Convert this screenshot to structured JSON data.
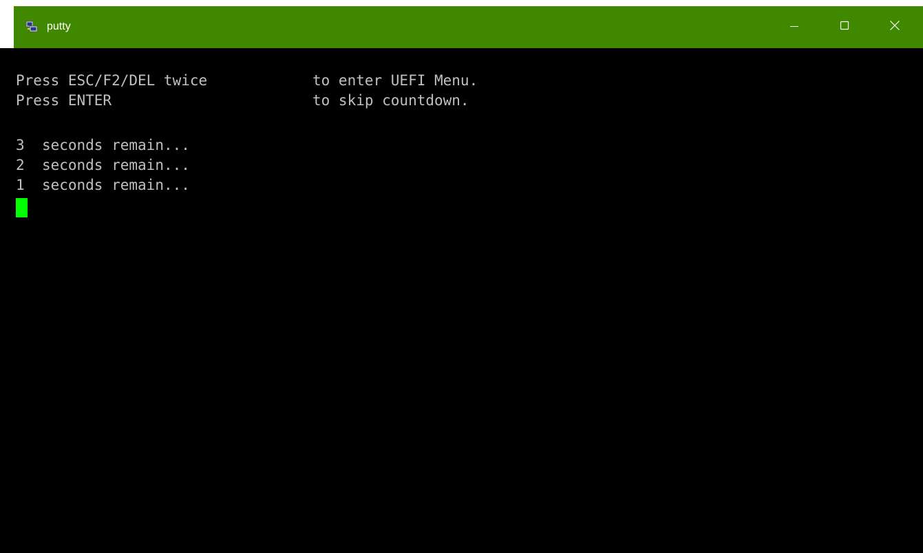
{
  "window": {
    "title": "putty",
    "app_icon": "putty-app-icon",
    "titlebar_color": "#3f8800",
    "buttons": {
      "minimize_icon": "minimize-icon",
      "maximize_icon": "maximize-icon",
      "close_icon": "close-icon"
    }
  },
  "terminal": {
    "background": "#000000",
    "text_color": "#c0c0c0",
    "cursor_color": "#00ff00",
    "prompts": [
      {
        "key": "Press ESC/F2/DEL twice",
        "action": "to enter UEFI Menu."
      },
      {
        "key": "Press ENTER",
        "action": "to skip countdown."
      }
    ],
    "countdown": [
      {
        "number": "3",
        "text": "seconds remain..."
      },
      {
        "number": "2",
        "text": "seconds remain..."
      },
      {
        "number": "1",
        "text": "seconds remain..."
      }
    ]
  }
}
